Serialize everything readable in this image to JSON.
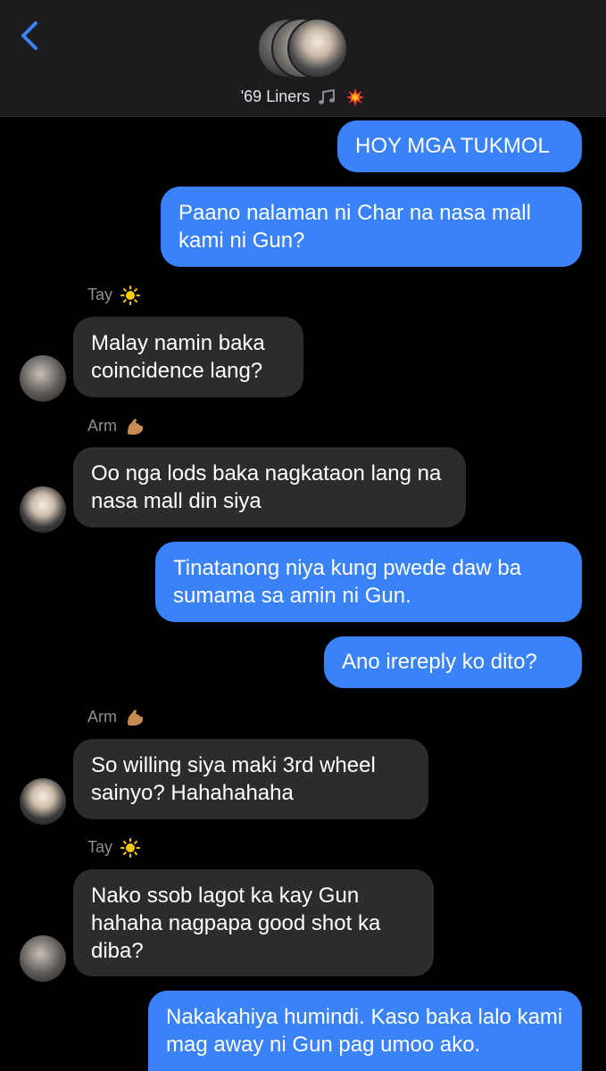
{
  "header": {
    "title": "'69 Liners",
    "title_emojis": [
      "musical-notes",
      "collision"
    ]
  },
  "messages": [
    {
      "side": "outgoing",
      "text": "HOY MGA TUKMOL"
    },
    {
      "side": "outgoing",
      "text": "Paano nalaman ni Char na nasa mall kami ni Gun?"
    },
    {
      "side": "incoming",
      "sender": "Tay",
      "sender_emoji": "sun",
      "text": "Malay namin baka coincidence lang?"
    },
    {
      "side": "incoming",
      "sender": "Arm",
      "sender_emoji": "flexed-biceps",
      "text": "Oo nga lods baka nagkataon lang na nasa mall din siya"
    },
    {
      "side": "outgoing",
      "text": "Tinatanong niya kung pwede daw ba sumama sa amin ni Gun."
    },
    {
      "side": "outgoing",
      "text": "Ano irereply ko dito?"
    },
    {
      "side": "incoming",
      "sender": "Arm",
      "sender_emoji": "flexed-biceps",
      "text": "So willing siya maki 3rd wheel sainyo? Hahahahaha"
    },
    {
      "side": "incoming",
      "sender": "Tay",
      "sender_emoji": "sun",
      "text": "Nako ssob lagot ka kay Gun hahaha nagpapa good shot ka diba?"
    },
    {
      "side": "outgoing",
      "text": "Nakakahiya humindi. Kaso baka lalo kami mag away ni Gun pag umoo ako."
    }
  ],
  "colors": {
    "outgoing_bubble": "#3a82f7",
    "incoming_bubble": "#2c2c2e",
    "accent": "#3a82f7",
    "background": "#000000"
  }
}
